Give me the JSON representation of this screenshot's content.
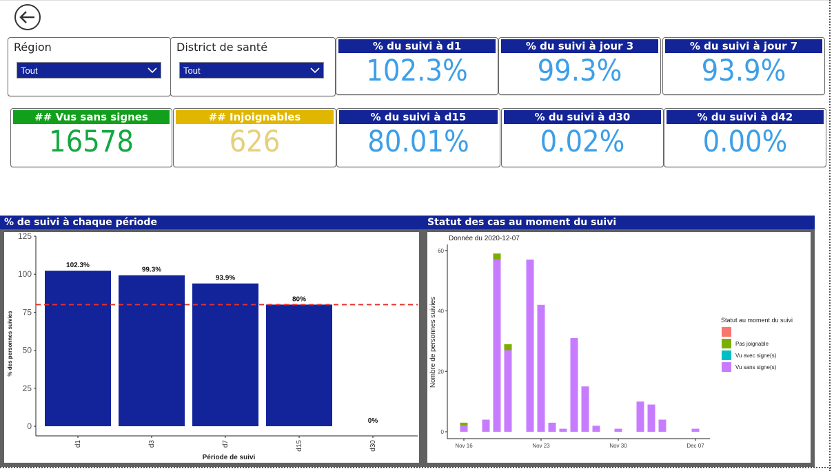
{
  "nav": {
    "back_icon": "back-arrow-icon"
  },
  "filters": [
    {
      "label": "Région",
      "value": "Tout"
    },
    {
      "label": "District de santé",
      "value": "Tout"
    }
  ],
  "kpis_row1": [
    {
      "title": "% du suivi à d1",
      "value": "102.3%"
    },
    {
      "title": "% du suivi à jour 3",
      "value": "99.3%"
    },
    {
      "title": "% du suivi à jour 7",
      "value": "93.9%"
    }
  ],
  "kpis_row2": [
    {
      "title": "## Vus sans signes",
      "value": "16578",
      "header_color": "#12a01c",
      "value_color": "#13a840"
    },
    {
      "title": "## Injoignables",
      "value": "626",
      "header_color": "#e0b600",
      "value_color": "#e6d07a"
    },
    {
      "title": "% du suivi à d15",
      "value": "80.01%"
    },
    {
      "title": "% du suivi à d30",
      "value": "0.02%"
    },
    {
      "title": "% du suivi à d42",
      "value": "0.00%"
    }
  ],
  "colors": {
    "header_blue": "#132496",
    "kpi_blue": "#3d9fe8",
    "bar_blue": "#13249a",
    "threshold_red": "#e8322c"
  },
  "panels": {
    "left_title": "% de suivi à chaque période",
    "right_title": "Statut des cas au moment du suivi"
  },
  "chart_data": [
    {
      "type": "bar",
      "title": "",
      "categories": [
        "d1",
        "d3",
        "d7",
        "d15",
        "d30"
      ],
      "values": [
        102.3,
        99.3,
        93.9,
        80,
        0
      ],
      "data_labels": [
        "102.3%",
        "99.3%",
        "93.9%",
        "80%",
        "0%"
      ],
      "xlabel": "Période de suivi",
      "ylabel": "% des personnes suivies",
      "ylim": [
        0,
        125
      ],
      "yticks": [
        0,
        25,
        50,
        75,
        100,
        125
      ],
      "reference_line": {
        "y": 80,
        "style": "dashed",
        "color": "#e8322c"
      },
      "grid": false
    },
    {
      "type": "bar",
      "stacked": true,
      "subtitle": "Donnée du 2020-12-07",
      "xlabel": "",
      "ylabel": "Nombre de personnes suivies",
      "ylim": [
        0,
        62
      ],
      "yticks": [
        0,
        20,
        40,
        60
      ],
      "xtick_labels": [
        "Nov 16",
        "Nov 23",
        "Nov 30",
        "Dec 07"
      ],
      "xtick_dates": [
        "2020-11-16",
        "2020-11-23",
        "2020-11-30",
        "2020-12-07"
      ],
      "legend_title": "Statut au moment du suivi",
      "legend_position": "right",
      "legend": [
        {
          "label": "",
          "color": "#f8766d"
        },
        {
          "label": "Pas joignable",
          "color": "#7cae00"
        },
        {
          "label": "Vu avec signe(s)",
          "color": "#00bfc4"
        },
        {
          "label": "Vu sans signe(s)",
          "color": "#c77cff"
        }
      ],
      "x": [
        "2020-11-16",
        "2020-11-18",
        "2020-11-19",
        "2020-11-20",
        "2020-11-22",
        "2020-11-23",
        "2020-11-24",
        "2020-11-25",
        "2020-11-26",
        "2020-11-27",
        "2020-11-28",
        "2020-11-30",
        "2020-12-02",
        "2020-12-03",
        "2020-12-04",
        "2020-12-07"
      ],
      "series": [
        {
          "name": "Pas joignable",
          "values": [
            1,
            0,
            2,
            2,
            0,
            0,
            0,
            0,
            0,
            0,
            0,
            0,
            0,
            0,
            0,
            0
          ]
        },
        {
          "name": "Vu sans signe(s)",
          "values": [
            2,
            4,
            57,
            27,
            57,
            42,
            3,
            1,
            31,
            15,
            2,
            1,
            10,
            9,
            4,
            1
          ]
        }
      ],
      "grid": false
    }
  ]
}
